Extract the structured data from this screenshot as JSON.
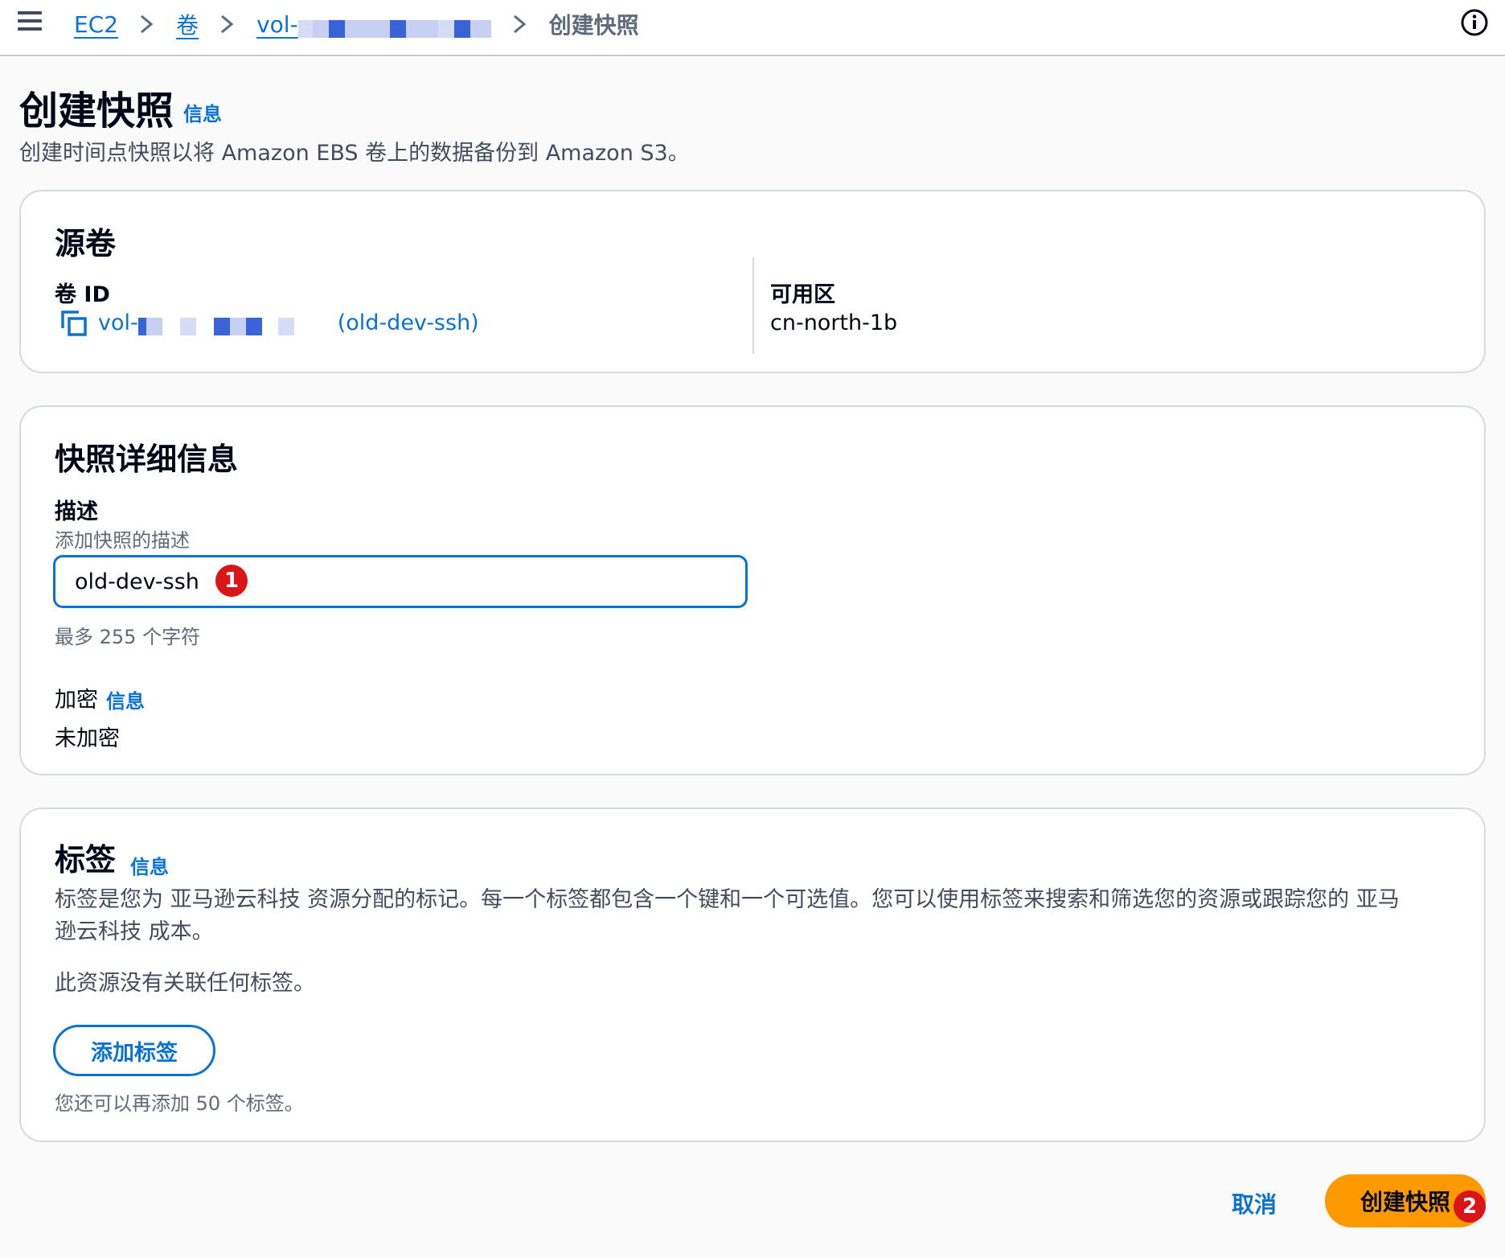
{
  "breadcrumb": {
    "items": [
      {
        "label": "EC2"
      },
      {
        "label": "卷"
      },
      {
        "label": "vol-"
      }
    ],
    "current": "创建快照"
  },
  "header": {
    "title": "创建快照",
    "info_label": "信息",
    "description": "创建时间点快照以将 Amazon EBS 卷上的数据备份到 Amazon S3。"
  },
  "source_volume": {
    "title": "源卷",
    "volume_id_label": "卷 ID",
    "volume_id_prefix": "vol-",
    "volume_name": "(old-dev-ssh)",
    "az_label": "可用区",
    "az_value": "cn-north-1b"
  },
  "snapshot_details": {
    "title": "快照详细信息",
    "description_label": "描述",
    "description_hint": "添加快照的描述",
    "description_value": "old-dev-ssh",
    "description_constraint": "最多 255 个字符",
    "encryption_label": "加密",
    "encryption_info": "信息",
    "encryption_value": "未加密",
    "annotation_1": "1"
  },
  "tags": {
    "title": "标签",
    "info_label": "信息",
    "description_line1": "标签是您为 亚马逊云科技 资源分配的标记。每一个标签都包含一个键和一个可选值。您可以使用标签来搜索和筛选您的资源或跟踪您的 亚马",
    "description_line2": "逊云科技 成本。",
    "empty_text": "此资源没有关联任何标签。",
    "add_button": "添加标签",
    "limit_text": "您还可以再添加 50 个标签。"
  },
  "footer": {
    "cancel_label": "取消",
    "create_label": "创建快照",
    "annotation_2": "2"
  },
  "colors": {
    "link": "#0972d3",
    "primary": "#ff9900",
    "badge": "#d91515",
    "border": "#d5dbdb"
  }
}
